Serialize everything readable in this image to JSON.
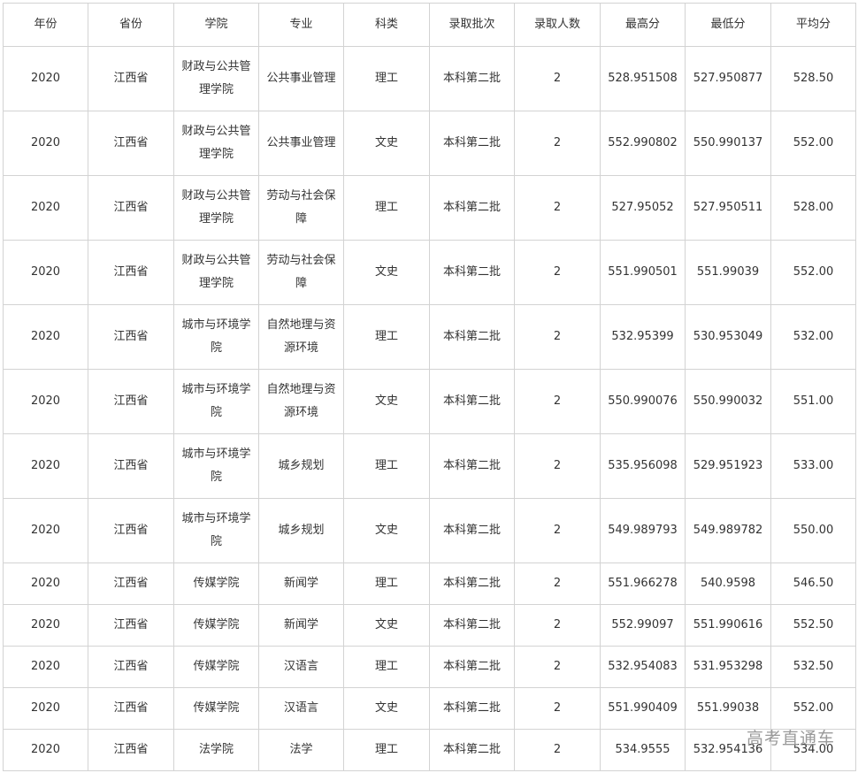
{
  "columns": [
    "年份",
    "省份",
    "学院",
    "专业",
    "科类",
    "录取批次",
    "录取人数",
    "最高分",
    "最低分",
    "平均分"
  ],
  "rows": [
    [
      "2020",
      "江西省",
      "财政与公共管理学院",
      "公共事业管理",
      "理工",
      "本科第二批",
      "2",
      "528.951508",
      "527.950877",
      "528.50"
    ],
    [
      "2020",
      "江西省",
      "财政与公共管理学院",
      "公共事业管理",
      "文史",
      "本科第二批",
      "2",
      "552.990802",
      "550.990137",
      "552.00"
    ],
    [
      "2020",
      "江西省",
      "财政与公共管理学院",
      "劳动与社会保障",
      "理工",
      "本科第二批",
      "2",
      "527.95052",
      "527.950511",
      "528.00"
    ],
    [
      "2020",
      "江西省",
      "财政与公共管理学院",
      "劳动与社会保障",
      "文史",
      "本科第二批",
      "2",
      "551.990501",
      "551.99039",
      "552.00"
    ],
    [
      "2020",
      "江西省",
      "城市与环境学院",
      "自然地理与资源环境",
      "理工",
      "本科第二批",
      "2",
      "532.95399",
      "530.953049",
      "532.00"
    ],
    [
      "2020",
      "江西省",
      "城市与环境学院",
      "自然地理与资源环境",
      "文史",
      "本科第二批",
      "2",
      "550.990076",
      "550.990032",
      "551.00"
    ],
    [
      "2020",
      "江西省",
      "城市与环境学院",
      "城乡规划",
      "理工",
      "本科第二批",
      "2",
      "535.956098",
      "529.951923",
      "533.00"
    ],
    [
      "2020",
      "江西省",
      "城市与环境学院",
      "城乡规划",
      "文史",
      "本科第二批",
      "2",
      "549.989793",
      "549.989782",
      "550.00"
    ],
    [
      "2020",
      "江西省",
      "传媒学院",
      "新闻学",
      "理工",
      "本科第二批",
      "2",
      "551.966278",
      "540.9598",
      "546.50"
    ],
    [
      "2020",
      "江西省",
      "传媒学院",
      "新闻学",
      "文史",
      "本科第二批",
      "2",
      "552.99097",
      "551.990616",
      "552.50"
    ],
    [
      "2020",
      "江西省",
      "传媒学院",
      "汉语言",
      "理工",
      "本科第二批",
      "2",
      "532.954083",
      "531.953298",
      "532.50"
    ],
    [
      "2020",
      "江西省",
      "传媒学院",
      "汉语言",
      "文史",
      "本科第二批",
      "2",
      "551.990409",
      "551.99038",
      "552.00"
    ],
    [
      "2020",
      "江西省",
      "法学院",
      "法学",
      "理工",
      "本科第二批",
      "2",
      "534.9555",
      "532.954136",
      "534.00"
    ]
  ],
  "watermark": "高考直通车"
}
